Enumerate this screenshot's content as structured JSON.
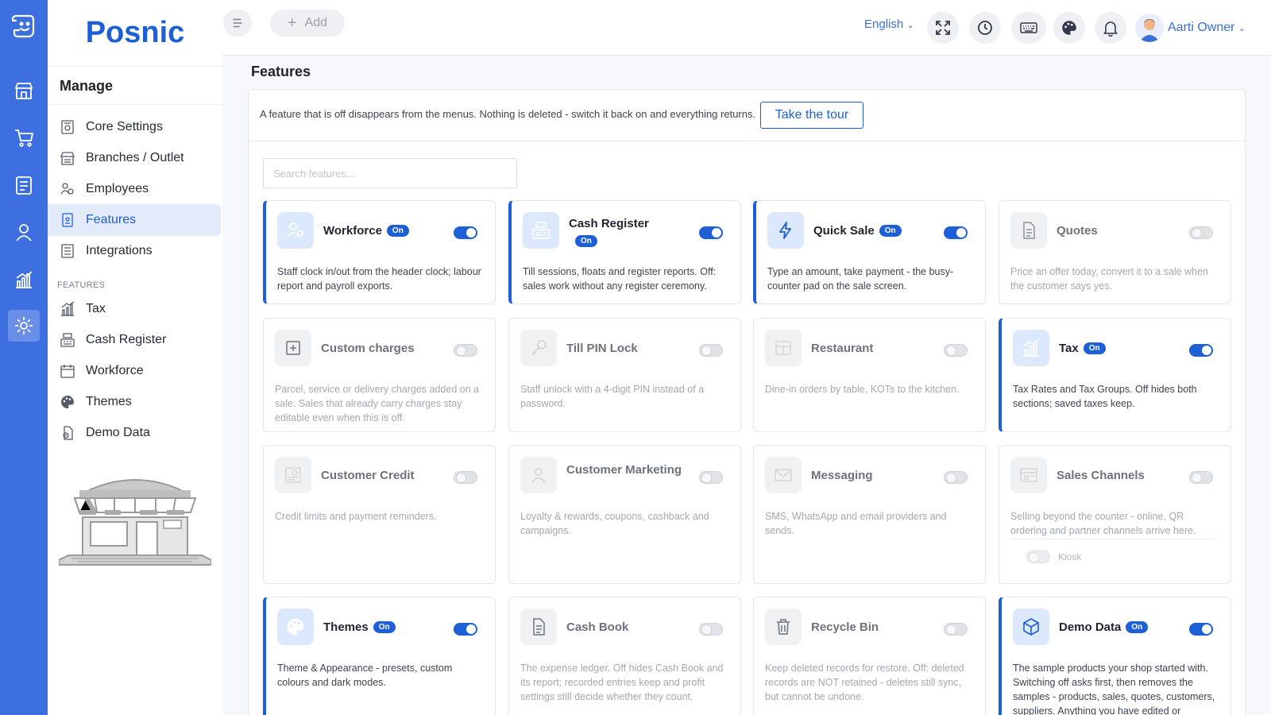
{
  "app": {
    "brand": "Posnic"
  },
  "colors": {
    "primary": "#1d5fd6",
    "rail": "#3e6fe0",
    "active_bg": "#e3ebfb"
  },
  "rail": {
    "items": [
      {
        "icon": "store-icon"
      },
      {
        "icon": "cart-icon"
      },
      {
        "icon": "clipboard-icon"
      },
      {
        "icon": "user-icon"
      },
      {
        "icon": "chart-icon"
      },
      {
        "icon": "gear-icon",
        "active": true
      }
    ]
  },
  "sidebar": {
    "manage_title": "Manage",
    "manage_items": [
      {
        "label": "Core Settings",
        "icon": "settings-doc-icon"
      },
      {
        "label": "Branches / Outlet",
        "icon": "branch-store-icon"
      },
      {
        "label": "Employees",
        "icon": "employees-gear-icon"
      },
      {
        "label": "Features",
        "icon": "features-doc-icon",
        "active": true
      },
      {
        "label": "Integrations",
        "icon": "integrations-list-icon"
      }
    ],
    "features_label": "FEATURES",
    "feature_items": [
      {
        "label": "Tax",
        "icon": "tax-chart-icon"
      },
      {
        "label": "Cash Register",
        "icon": "cash-register-icon"
      },
      {
        "label": "Workforce",
        "icon": "workforce-calendar-icon"
      },
      {
        "label": "Themes",
        "icon": "palette-icon"
      },
      {
        "label": "Demo Data",
        "icon": "demo-data-icon"
      }
    ]
  },
  "topbar": {
    "add_label": "Add",
    "language": "English",
    "icons": [
      "fullscreen-icon",
      "clock-icon",
      "keyboard-icon",
      "palette-icon",
      "bell-icon"
    ],
    "user_name": "Aarti Owner"
  },
  "main": {
    "title": "Features",
    "notice": "A feature that is off disappears from the menus. Nothing is deleted - switch it back on and everything returns.",
    "tour_button": "Take the tour",
    "search_placeholder": "Search features...",
    "badge_on": "On",
    "cards": [
      {
        "title": "Workforce",
        "on": true,
        "icon": "workforce-gear-icon",
        "desc": "Staff clock in/out from the header clock; labour report and payroll exports."
      },
      {
        "title": "Cash Register",
        "on": true,
        "icon": "cash-register-icon",
        "desc": "Till sessions, floats and register reports. Off: sales work without any register ceremony."
      },
      {
        "title": "Quick Sale",
        "on": true,
        "icon": "lightning-icon",
        "desc": "Type an amount, take payment - the busy-counter pad on the sale screen."
      },
      {
        "title": "Quotes",
        "on": false,
        "icon": "document-icon",
        "desc": "Price an offer today, convert it to a sale when the customer says yes."
      },
      {
        "title": "Custom charges",
        "on": false,
        "icon": "plus-square-icon",
        "desc": "Parcel, service or delivery charges added on a sale. Sales that already carry charges stay editable even when this is off."
      },
      {
        "title": "Till PIN Lock",
        "on": false,
        "icon": "key-icon",
        "desc": "Staff unlock with a 4-digit PIN instead of a password."
      },
      {
        "title": "Restaurant",
        "on": false,
        "icon": "table-icon",
        "desc": "Dine-in orders by table, KOTs to the kitchen."
      },
      {
        "title": "Tax",
        "on": true,
        "icon": "tax-chart-icon",
        "desc": "Tax Rates and Tax Groups. Off hides both sections; saved taxes keep."
      },
      {
        "title": "Customer Credit",
        "on": false,
        "icon": "credit-icon",
        "desc": "Credit limits and payment reminders."
      },
      {
        "title": "Customer Marketing",
        "on": false,
        "icon": "person-icon",
        "desc": "Loyalty & rewards, coupons, cashback and campaigns."
      },
      {
        "title": "Messaging",
        "on": false,
        "icon": "envelope-icon",
        "desc": "SMS, WhatsApp and email providers and sends."
      },
      {
        "title": "Sales Channels",
        "on": false,
        "icon": "channels-icon",
        "desc": "Selling beyond the counter - online, QR ordering and partner channels arrive here.",
        "sub": "Kiosk"
      },
      {
        "title": "Themes",
        "on": true,
        "icon": "palette-icon",
        "desc": "Theme & Appearance - presets, custom colours and dark modes."
      },
      {
        "title": "Cash Book",
        "on": false,
        "icon": "document-icon",
        "desc": "The expense ledger. Off hides Cash Book and its report; recorded entries keep and profit settings still decide whether they count."
      },
      {
        "title": "Recycle Bin",
        "on": false,
        "icon": "trash-icon",
        "desc": "Keep deleted records for restore. Off: deleted records are NOT retained - deletes still sync, but cannot be undone."
      },
      {
        "title": "Demo Data",
        "on": true,
        "icon": "cube-icon",
        "desc": "The sample products your shop started with. Switching off asks first, then removes the samples - products, sales, quotes, customers, suppliers. Anything you have edited or"
      }
    ]
  }
}
